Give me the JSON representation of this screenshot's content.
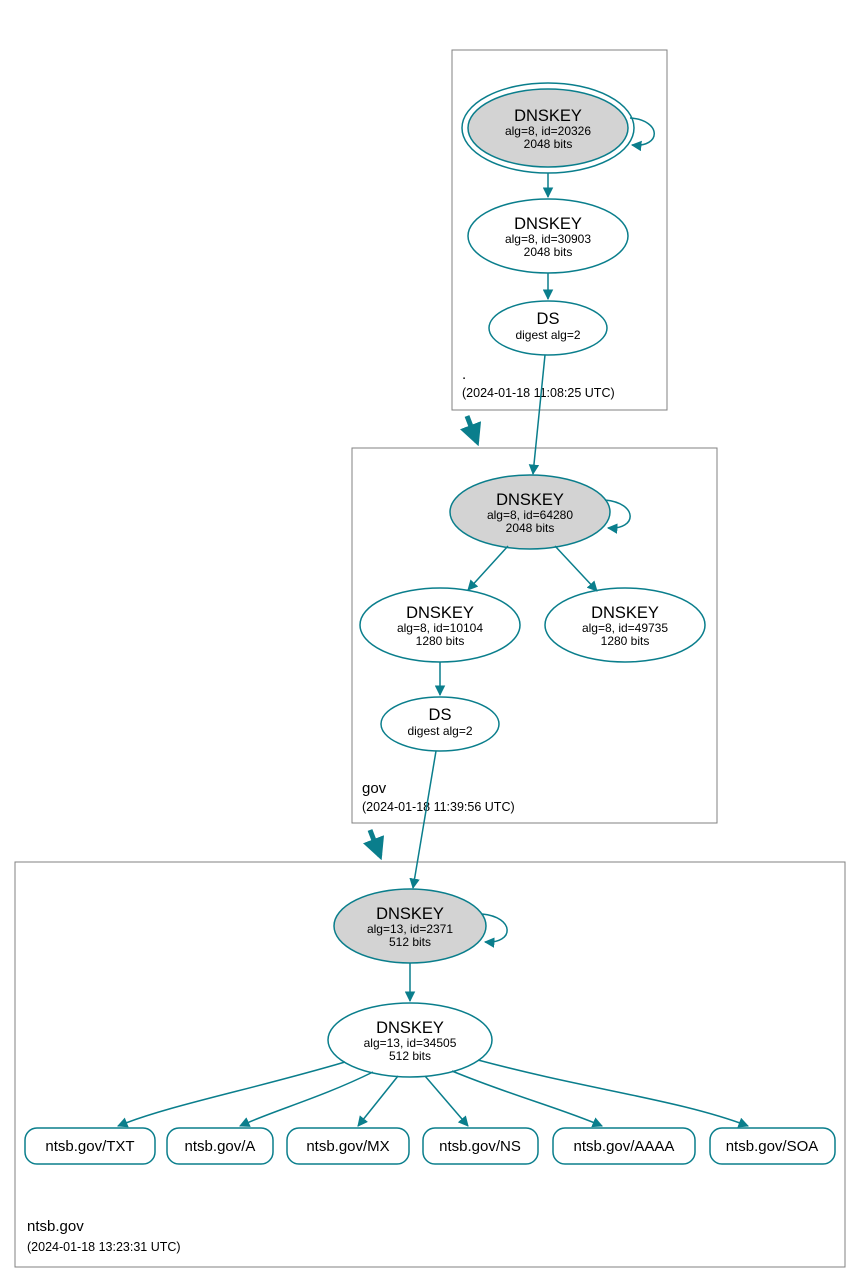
{
  "zones": {
    "root": {
      "name": ".",
      "timestamp": "(2024-01-18 11:08:25 UTC)"
    },
    "gov": {
      "name": "gov",
      "timestamp": "(2024-01-18 11:39:56 UTC)"
    },
    "ntsb": {
      "name": "ntsb.gov",
      "timestamp": "(2024-01-18 13:23:31 UTC)"
    }
  },
  "nodes": {
    "root_ksk": {
      "title": "DNSKEY",
      "line2": "alg=8, id=20326",
      "line3": "2048 bits"
    },
    "root_zsk": {
      "title": "DNSKEY",
      "line2": "alg=8, id=30903",
      "line3": "2048 bits"
    },
    "root_ds": {
      "title": "DS",
      "line2": "digest alg=2"
    },
    "gov_ksk": {
      "title": "DNSKEY",
      "line2": "alg=8, id=64280",
      "line3": "2048 bits"
    },
    "gov_zsk1": {
      "title": "DNSKEY",
      "line2": "alg=8, id=10104",
      "line3": "1280 bits"
    },
    "gov_zsk2": {
      "title": "DNSKEY",
      "line2": "alg=8, id=49735",
      "line3": "1280 bits"
    },
    "gov_ds": {
      "title": "DS",
      "line2": "digest alg=2"
    },
    "ntsb_ksk": {
      "title": "DNSKEY",
      "line2": "alg=13, id=2371",
      "line3": "512 bits"
    },
    "ntsb_zsk": {
      "title": "DNSKEY",
      "line2": "alg=13, id=34505",
      "line3": "512 bits"
    }
  },
  "records": {
    "txt": "ntsb.gov/TXT",
    "a": "ntsb.gov/A",
    "mx": "ntsb.gov/MX",
    "ns": "ntsb.gov/NS",
    "aaaa": "ntsb.gov/AAAA",
    "soa": "ntsb.gov/SOA"
  }
}
